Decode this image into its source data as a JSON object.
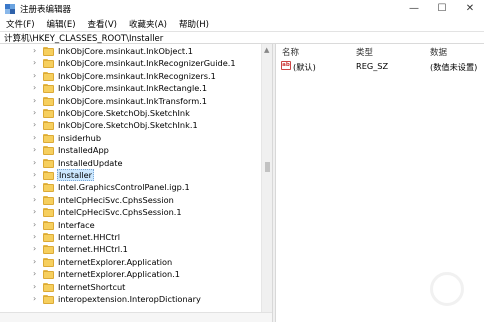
{
  "window": {
    "title": "注册表编辑器",
    "minimize_glyph": "—",
    "maximize_glyph": "☐",
    "close_glyph": "✕"
  },
  "menu": [
    "文件(F)",
    "编辑(E)",
    "查看(V)",
    "收藏夹(A)",
    "帮助(H)"
  ],
  "address": "计算机\\HKEY_CLASSES_ROOT\\Installer",
  "tree": {
    "items": [
      {
        "label": "InkObjCore.msinkaut.InkObject.1"
      },
      {
        "label": "InkObjCore.msinkaut.InkRecognizerGuide.1"
      },
      {
        "label": "InkObjCore.msinkaut.InkRecognizers.1"
      },
      {
        "label": "InkObjCore.msinkaut.InkRectangle.1"
      },
      {
        "label": "InkObjCore.msinkaut.InkTransform.1"
      },
      {
        "label": "InkObjCore.SketchObj.SketchInk"
      },
      {
        "label": "InkObjCore.SketchObj.SketchInk.1"
      },
      {
        "label": "insiderhub"
      },
      {
        "label": "InstalledApp"
      },
      {
        "label": "InstalledUpdate"
      },
      {
        "label": "Installer",
        "selected": true
      },
      {
        "label": "Intel.GraphicsControlPanel.igp.1"
      },
      {
        "label": "IntelCpHeciSvc.CphsSession"
      },
      {
        "label": "IntelCpHeciSvc.CphsSession.1"
      },
      {
        "label": "Interface"
      },
      {
        "label": "Internet.HHCtrl"
      },
      {
        "label": "Internet.HHCtrl.1"
      },
      {
        "label": "InternetExplorer.Application"
      },
      {
        "label": "InternetExplorer.Application.1"
      },
      {
        "label": "InternetShortcut"
      },
      {
        "label": "interopextension.InteropDictionary"
      }
    ]
  },
  "list": {
    "columns": {
      "name": "名称",
      "type": "类型",
      "data": "数据"
    },
    "rows": [
      {
        "icon": "ab",
        "name": "(默认)",
        "type": "REG_SZ",
        "data": "(数值未设置)"
      }
    ]
  },
  "colors": {
    "folder": "#f6cf5e",
    "selection": "#cce8ff"
  },
  "icons": {
    "app": "registry-editor-icon",
    "expand": "chevron-right-icon",
    "folder": "folder-icon",
    "value": "string-value-icon"
  }
}
